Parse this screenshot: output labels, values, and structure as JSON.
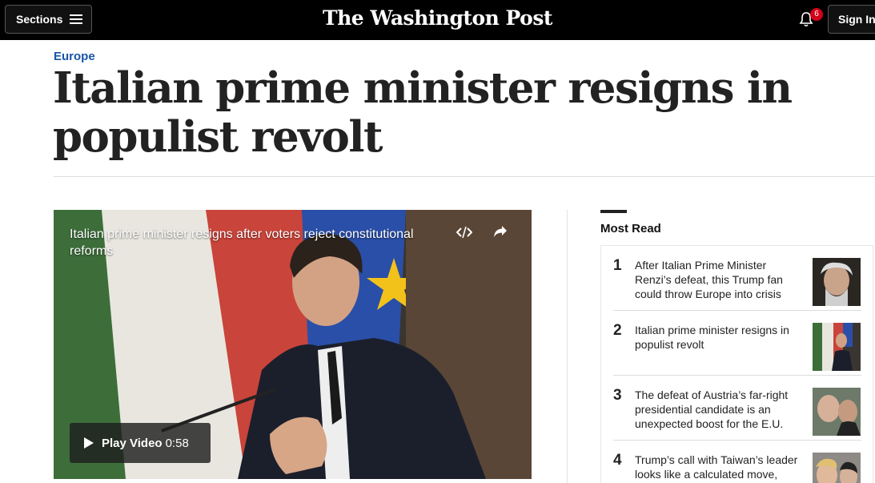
{
  "header": {
    "sections_label": "Sections",
    "logo": "The Washington Post",
    "notifications_count": "6",
    "signin_label": "Sign In"
  },
  "article": {
    "kicker": "Europe",
    "headline": "Italian prime minister resigns in populist revolt"
  },
  "video": {
    "title": "Italian prime minister resigns after voters reject constitutional reforms",
    "play_label": "Play Video",
    "duration": "0:58"
  },
  "most_read": {
    "title": "Most Read",
    "items": [
      {
        "rank": "1",
        "text": "After Italian Prime Minister Renzi’s defeat, this Trump fan could throw Europe into crisis"
      },
      {
        "rank": "2",
        "text": "Italian prime minister resigns in populist revolt"
      },
      {
        "rank": "3",
        "text": "The defeat of Austria’s far-right presidential candidate is an unexpected boost for the E.U."
      },
      {
        "rank": "4",
        "text": "Trump’s call with Taiwan’s leader looks like a calculated move,"
      }
    ]
  },
  "colors": {
    "topbar": "#000000",
    "kicker": "#1955a5",
    "badge": "#d0021b"
  }
}
